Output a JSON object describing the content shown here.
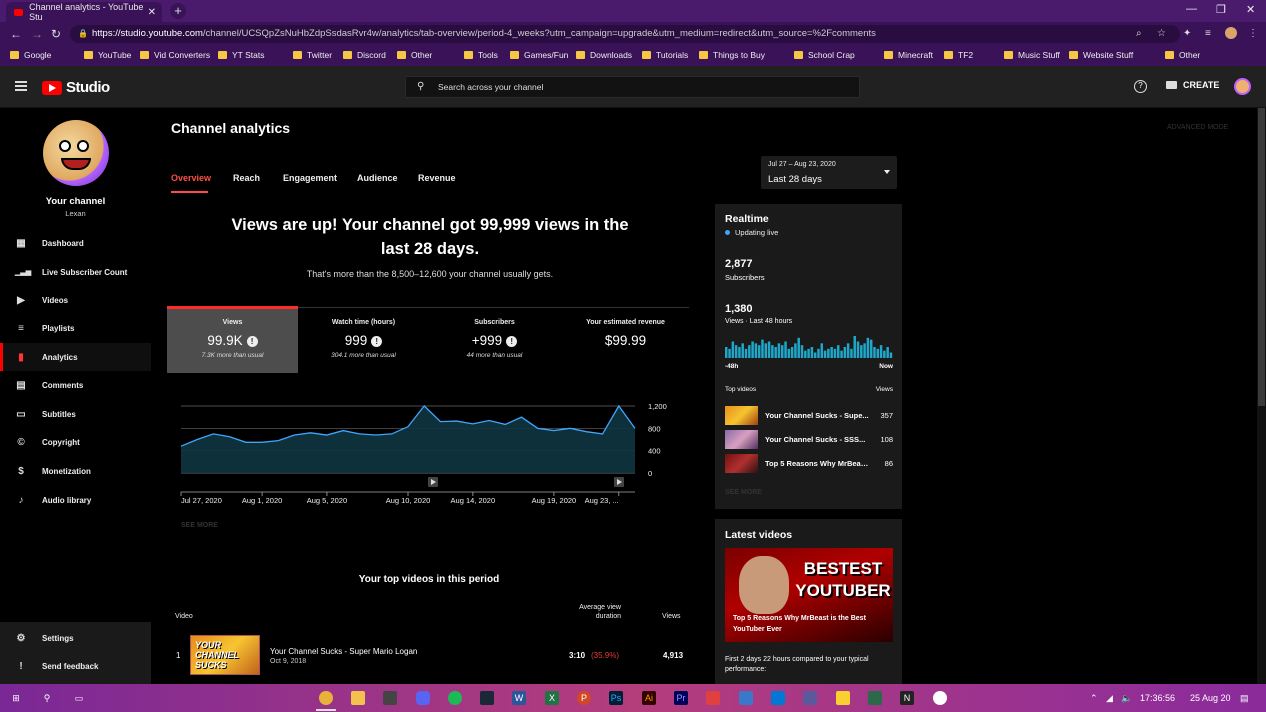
{
  "browser": {
    "tab_title": "Channel analytics - YouTube Stu",
    "tab_close": "✕",
    "new_tab": "+",
    "url_host": "https://studio.youtube.com",
    "url_path": "/channel/UCSQpZsNuHbZdpSsdasRvr4w/analytics/tab-overview/period-4_weeks?utm_campaign=upgrade&utm_medium=redirect&utm_source=%2Fcomments",
    "bookmarks": [
      "Google",
      "YouTube",
      "Vid Converters",
      "YT Stats",
      "Twitter",
      "Discord",
      "Other",
      "Tools",
      "Games/Fun",
      "Downloads",
      "Tutorials",
      "Things to Buy",
      "School Crap",
      "Minecraft",
      "TF2",
      "Music Stuff",
      "Website Stuff",
      "Other"
    ]
  },
  "header": {
    "logo_text": "Studio",
    "search_placeholder": "Search across your channel",
    "help": "?",
    "create_label": "CREATE"
  },
  "sidebar": {
    "channel_title": "Your channel",
    "channel_name": "Lexan",
    "items": [
      {
        "label": "Dashboard",
        "icon": "dashboard-icon",
        "glyph": "▦"
      },
      {
        "label": "Live Subscriber Count",
        "icon": "signal-icon",
        "glyph": "▁▃▅"
      },
      {
        "label": "Videos",
        "icon": "video-library-icon",
        "glyph": "▶"
      },
      {
        "label": "Playlists",
        "icon": "playlist-icon",
        "glyph": "≡"
      },
      {
        "label": "Analytics",
        "icon": "analytics-icon",
        "glyph": "▮"
      },
      {
        "label": "Comments",
        "icon": "comments-icon",
        "glyph": "▤"
      },
      {
        "label": "Subtitles",
        "icon": "subtitles-icon",
        "glyph": "▭"
      },
      {
        "label": "Copyright",
        "icon": "copyright-icon",
        "glyph": "©"
      },
      {
        "label": "Monetization",
        "icon": "dollar-icon",
        "glyph": "$"
      },
      {
        "label": "Audio library",
        "icon": "audio-library-icon",
        "glyph": "♪"
      }
    ],
    "settings": "Settings",
    "feedback": "Send feedback"
  },
  "main": {
    "title": "Channel analytics",
    "advanced_mode": "ADVANCED MODE",
    "tabs": [
      "Overview",
      "Reach",
      "Engagement",
      "Audience",
      "Revenue"
    ],
    "date_range": "Jul 27 – Aug 23, 2020",
    "date_period": "Last 28 days",
    "headline": "Views are up! Your channel got 99,999 views in the last 28 days.",
    "subhead": "That's more than the 8,500–12,600 your channel usually gets.",
    "metrics": [
      {
        "label": "Views",
        "value": "99.9K",
        "note": "7.3K more than usual",
        "info": true
      },
      {
        "label": "Watch time (hours)",
        "value": "999",
        "note": "304.1 more than usual",
        "info": true
      },
      {
        "label": "Subscribers",
        "value": "+999",
        "note": "44 more than usual",
        "info": true
      },
      {
        "label": "Your estimated revenue",
        "value": "$99.99",
        "note": "",
        "info": false
      }
    ],
    "info_glyph": "!",
    "see_more": "SEE MORE",
    "top_videos_title": "Your top videos in this period",
    "top_videos_headers": {
      "video": "Video",
      "avd": "Average view duration",
      "views": "Views"
    },
    "top_videos": [
      {
        "rank": "1",
        "title": "Your Channel Sucks - Super Mario Logan",
        "date": "Oct 9, 2018",
        "duration": "3:10",
        "pct": "(35.9%)",
        "views": "4,913",
        "thumb_text": "YOUR CHANNEL SUCKS"
      }
    ]
  },
  "chart_data": {
    "type": "area",
    "x": [
      "Jul 27, 2020",
      "Jul 28",
      "Jul 29",
      "Jul 30",
      "Jul 31",
      "Aug 1, 2020",
      "Aug 2",
      "Aug 3",
      "Aug 4",
      "Aug 5, 2020",
      "Aug 6",
      "Aug 7",
      "Aug 8",
      "Aug 9",
      "Aug 10, 2020",
      "Aug 11",
      "Aug 12",
      "Aug 13",
      "Aug 14, 2020",
      "Aug 15",
      "Aug 16",
      "Aug 17",
      "Aug 18",
      "Aug 19, 2020",
      "Aug 20",
      "Aug 21",
      "Aug 22",
      "Aug 23, ..."
    ],
    "xticks": [
      "Jul 27, 2020",
      "Aug 1, 2020",
      "Aug 5, 2020",
      "Aug 10, 2020",
      "Aug 14, 2020",
      "Aug 19, 2020",
      "Aug 23, ..."
    ],
    "series": [
      {
        "values": [
          480,
          600,
          700,
          650,
          550,
          550,
          580,
          680,
          720,
          680,
          760,
          700,
          680,
          700,
          830,
          1200,
          920,
          930,
          880,
          940,
          870,
          1000,
          800,
          760,
          800,
          740,
          700,
          1200,
          800
        ]
      }
    ],
    "yticks": [
      "0",
      "400",
      "800",
      "1,200"
    ],
    "ylim": [
      0,
      1200
    ],
    "grid": true,
    "color": "#3ea6ff"
  },
  "realtime": {
    "title": "Realtime",
    "live": "Updating live",
    "subscribers": "2,877",
    "subscribers_label": "Subscribers",
    "views": "1,380",
    "views_label": "Views · Last 48 hours",
    "bars": [
      6,
      5,
      9,
      7,
      6,
      8,
      5,
      7,
      9,
      8,
      7,
      10,
      8,
      9,
      7,
      6,
      8,
      7,
      9,
      5,
      6,
      8,
      11,
      7,
      4,
      5,
      6,
      3,
      5,
      8,
      4,
      5,
      6,
      5,
      7,
      4,
      6,
      8,
      5,
      12,
      9,
      7,
      8,
      11,
      10,
      6,
      5,
      7,
      4,
      6,
      3
    ],
    "axis_left": "-48h",
    "axis_right": "Now",
    "top_videos_label": "Top videos",
    "views_col": "Views",
    "top_videos": [
      {
        "title": "Your Channel Sucks - Supe...",
        "views": "357"
      },
      {
        "title": "Your Channel Sucks - SSS...",
        "views": "108"
      },
      {
        "title": "Top 5 Reasons Why MrBeas...",
        "views": "86"
      }
    ],
    "see_more": "SEE MORE"
  },
  "latest": {
    "title": "Latest videos",
    "thumb_big": "BESTEST YOUTUBER",
    "video_title": "Top 5 Reasons Why MrBeast is the Best YouTuber Ever",
    "description": "First 2 days 22 hours compared to your typical performance:"
  },
  "taskbar": {
    "time": "17:36:56",
    "date": "25 Aug 20"
  }
}
